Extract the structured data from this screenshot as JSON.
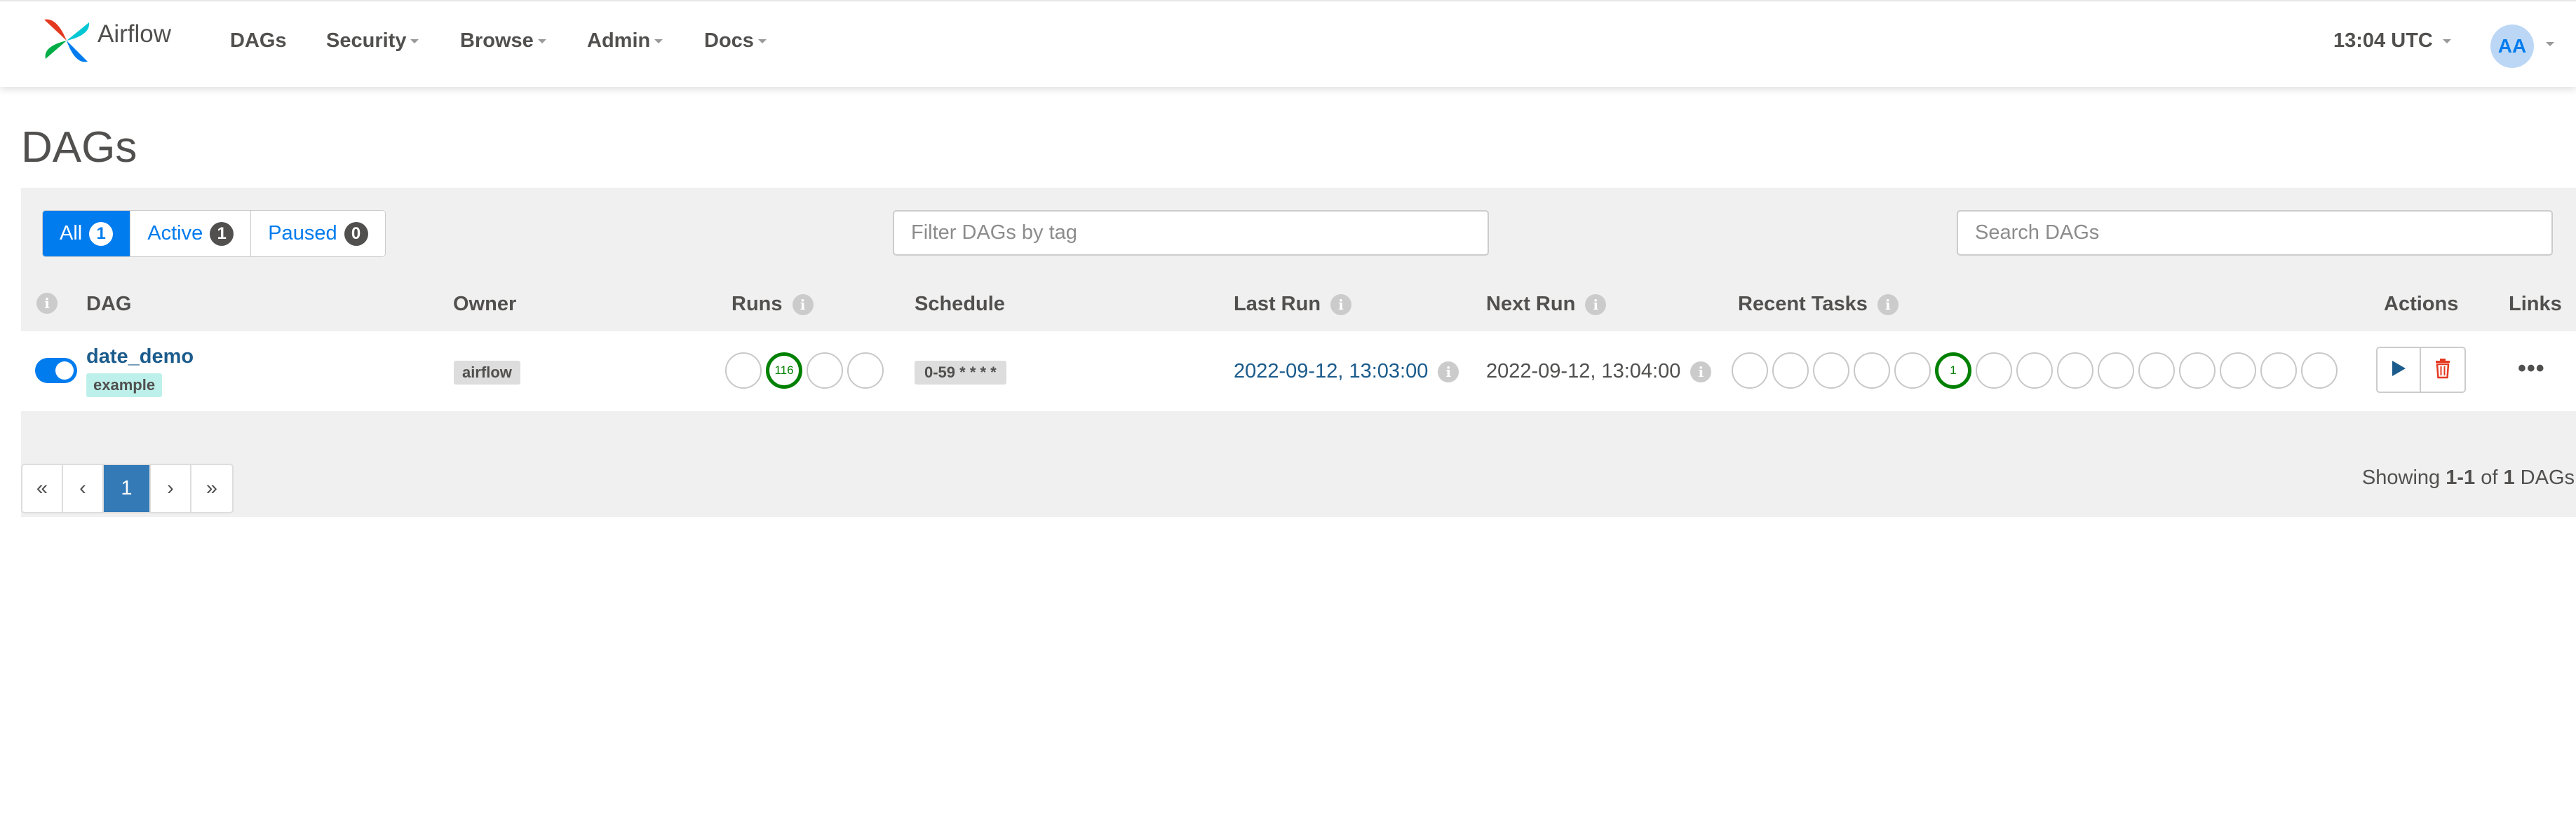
{
  "navbar": {
    "brand": "Airflow",
    "items": [
      {
        "label": "DAGs",
        "dropdown": false
      },
      {
        "label": "Security",
        "dropdown": true
      },
      {
        "label": "Browse",
        "dropdown": true
      },
      {
        "label": "Admin",
        "dropdown": true
      },
      {
        "label": "Docs",
        "dropdown": true
      }
    ],
    "clock": "13:04 UTC",
    "user_initials": "AA"
  },
  "page": {
    "title": "DAGs"
  },
  "filters": {
    "all_label": "All",
    "all_count": "1",
    "active_label": "Active",
    "active_count": "1",
    "paused_label": "Paused",
    "paused_count": "0",
    "tag_placeholder": "Filter DAGs by tag",
    "search_placeholder": "Search DAGs"
  },
  "table": {
    "headers": {
      "dag": "DAG",
      "owner": "Owner",
      "runs": "Runs",
      "schedule": "Schedule",
      "last_run": "Last Run",
      "next_run": "Next Run",
      "recent_tasks": "Recent Tasks",
      "actions": "Actions",
      "links": "Links"
    },
    "rows": [
      {
        "enabled": true,
        "dag_id": "date_demo",
        "tag": "example",
        "owner": "airflow",
        "runs": [
          "",
          "116",
          "",
          ""
        ],
        "schedule": "0-59 * * * *",
        "last_run": "2022-09-12, 13:03:00",
        "next_run": "2022-09-12, 13:04:00",
        "recent_tasks": [
          "",
          "",
          "",
          "",
          "",
          "1",
          "",
          "",
          "",
          "",
          "",
          "",
          "",
          "",
          ""
        ],
        "links_label": "•••"
      }
    ]
  },
  "pagination": {
    "first": "«",
    "prev": "‹",
    "current": "1",
    "next": "›",
    "last": "»",
    "showing_prefix": "Showing",
    "range": "1-1",
    "of": "of",
    "total": "1",
    "suffix": "DAGs"
  },
  "colors": {
    "primary": "#017cee",
    "success": "#008000",
    "danger": "#e43921",
    "link": "#1c5c8c",
    "tag_bg": "#bdf0ea"
  },
  "icons": {
    "info": "i",
    "trigger": "play-icon",
    "delete": "trash-icon"
  }
}
